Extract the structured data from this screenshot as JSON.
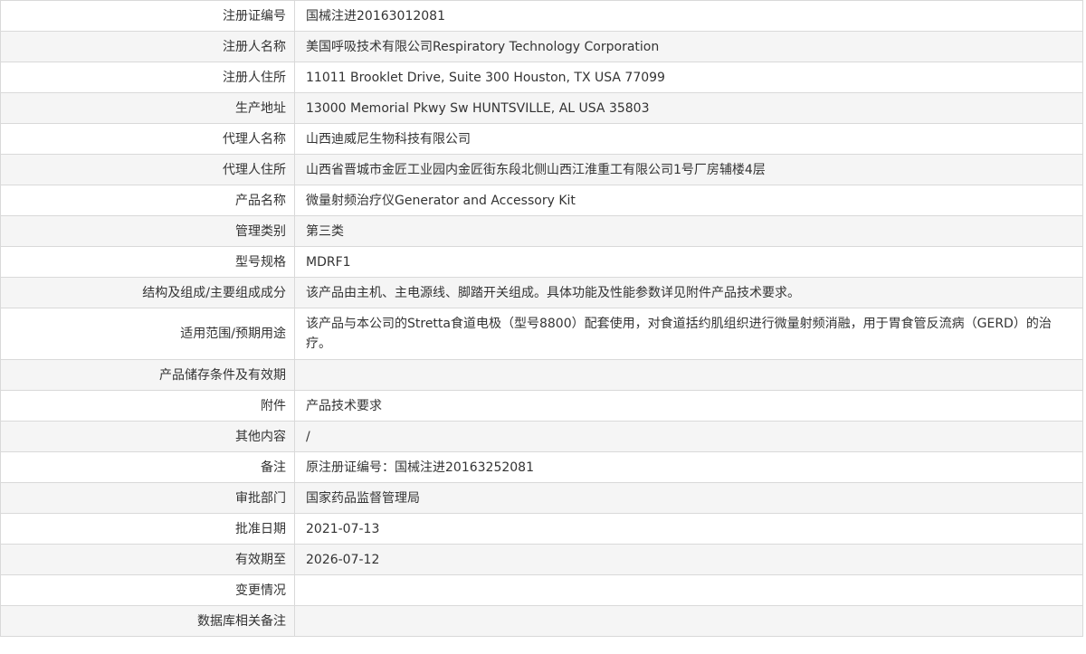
{
  "records": [
    {
      "label": "注册证编号",
      "value": "国械注进20163012081"
    },
    {
      "label": "注册人名称",
      "value": "美国呼吸技术有限公司Respiratory Technology Corporation"
    },
    {
      "label": "注册人住所",
      "value": "11011 Brooklet Drive, Suite 300 Houston, TX USA 77099"
    },
    {
      "label": "生产地址",
      "value": "13000 Memorial Pkwy Sw HUNTSVILLE, AL USA 35803"
    },
    {
      "label": "代理人名称",
      "value": "山西迪威尼生物科技有限公司"
    },
    {
      "label": "代理人住所",
      "value": "山西省晋城市金匠工业园内金匠街东段北侧山西江淮重工有限公司1号厂房辅楼4层"
    },
    {
      "label": "产品名称",
      "value": "微量射频治疗仪Generator and Accessory Kit"
    },
    {
      "label": "管理类别",
      "value": "第三类"
    },
    {
      "label": "型号规格",
      "value": "MDRF1"
    },
    {
      "label": "结构及组成/主要组成成分",
      "value": "该产品由主机、主电源线、脚踏开关组成。具体功能及性能参数详见附件产品技术要求。"
    },
    {
      "label": "适用范围/预期用途",
      "value": "该产品与本公司的Stretta食道电极（型号8800）配套使用，对食道括约肌组织进行微量射频消融，用于胃食管反流病（GERD）的治疗。"
    },
    {
      "label": "产品储存条件及有效期",
      "value": ""
    },
    {
      "label": "附件",
      "value": "产品技术要求"
    },
    {
      "label": "其他内容",
      "value": "/"
    },
    {
      "label": "备注",
      "value": "原注册证编号：国械注进20163252081"
    },
    {
      "label": "审批部门",
      "value": "国家药品监督管理局"
    },
    {
      "label": "批准日期",
      "value": "2021-07-13"
    },
    {
      "label": "有效期至",
      "value": "2026-07-12"
    },
    {
      "label": "变更情况",
      "value": ""
    },
    {
      "label": "数据库相关备注",
      "value": ""
    }
  ]
}
